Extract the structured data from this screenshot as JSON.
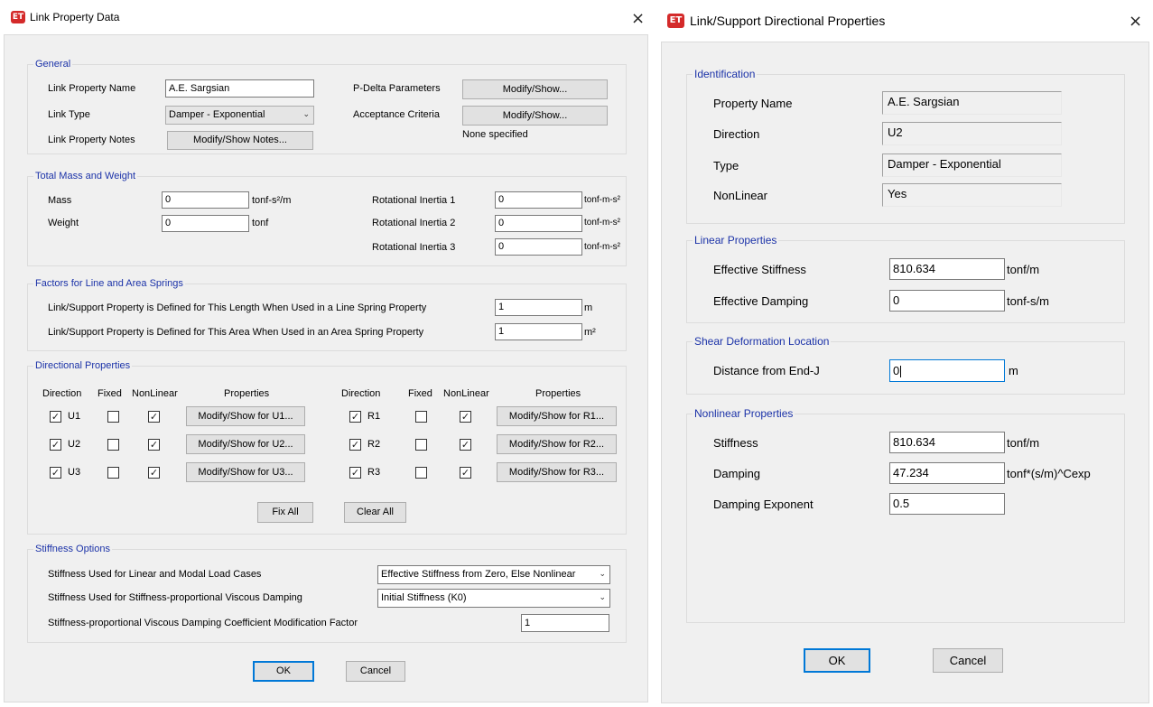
{
  "app_icon_text": "ET",
  "close_glyph": "×",
  "link_dialog": {
    "title": "Link Property Data",
    "general": {
      "title": "General",
      "name_label": "Link Property Name",
      "name_value": "A.E. Sargsian",
      "type_label": "Link Type",
      "type_value": "Damper - Exponential",
      "notes_label": "Link Property Notes",
      "notes_button": "Modify/Show Notes...",
      "pdelta_label": "P-Delta Parameters",
      "pdelta_button": "Modify/Show...",
      "accept_label": "Acceptance Criteria",
      "accept_button": "Modify/Show...",
      "accept_status": "None specified"
    },
    "mass": {
      "title": "Total Mass and Weight",
      "mass_label": "Mass",
      "mass_value": "0",
      "mass_unit": "tonf-s²/m",
      "weight_label": "Weight",
      "weight_value": "0",
      "weight_unit": "tonf",
      "ri1_label": "Rotational Inertia 1",
      "ri1_value": "0",
      "ri1_unit": "tonf-m-s²",
      "ri2_label": "Rotational Inertia 2",
      "ri2_value": "0",
      "ri2_unit": "tonf-m-s²",
      "ri3_label": "Rotational Inertia 3",
      "ri3_value": "0",
      "ri3_unit": "tonf-m-s²"
    },
    "factors": {
      "title": "Factors for Line and Area Springs",
      "line_label": "Link/Support Property is Defined for This Length When Used in a Line Spring Property",
      "line_value": "1",
      "line_unit": "m",
      "area_label": "Link/Support Property is Defined for This Area When Used in an Area Spring Property",
      "area_value": "1",
      "area_unit": "m²"
    },
    "directional": {
      "title": "Directional Properties",
      "headers": {
        "direction": "Direction",
        "fixed": "Fixed",
        "nonlinear": "NonLinear",
        "properties": "Properties"
      },
      "left_rows": [
        {
          "dir": "U1",
          "button": "Modify/Show for U1..."
        },
        {
          "dir": "U2",
          "button": "Modify/Show for U2..."
        },
        {
          "dir": "U3",
          "button": "Modify/Show for U3..."
        }
      ],
      "right_rows": [
        {
          "dir": "R1",
          "button": "Modify/Show for R1..."
        },
        {
          "dir": "R2",
          "button": "Modify/Show for R2..."
        },
        {
          "dir": "R3",
          "button": "Modify/Show for R3..."
        }
      ],
      "fix_all": "Fix All",
      "clear_all": "Clear All"
    },
    "stiffness": {
      "title": "Stiffness Options",
      "linear_label": "Stiffness Used for Linear and Modal Load Cases",
      "linear_value": "Effective Stiffness from Zero, Else Nonlinear",
      "prop_label": "Stiffness Used for Stiffness-proportional Viscous Damping",
      "prop_value": "Initial Stiffness (K0)",
      "coef_label": "Stiffness-proportional Viscous Damping Coefficient Modification Factor",
      "coef_value": "1"
    },
    "ok": "OK",
    "cancel": "Cancel"
  },
  "dir_dialog": {
    "title": "Link/Support Directional Properties",
    "identification": {
      "title": "Identification",
      "name_label": "Property Name",
      "name_value": "A.E. Sargsian",
      "dir_label": "Direction",
      "dir_value": "U2",
      "type_label": "Type",
      "type_value": "Damper - Exponential",
      "nl_label": "NonLinear",
      "nl_value": "Yes"
    },
    "linear": {
      "title": "Linear Properties",
      "eff_stiff_label": "Effective Stiffness",
      "eff_stiff_value": "810.634",
      "eff_stiff_unit": "tonf/m",
      "eff_damp_label": "Effective Damping",
      "eff_damp_value": "0",
      "eff_damp_unit": "tonf-s/m"
    },
    "shear": {
      "title": "Shear Deformation Location",
      "dist_label": "Distance from End-J",
      "dist_value": "0",
      "dist_unit": "m"
    },
    "nonlinear": {
      "title": "Nonlinear Properties",
      "stiff_label": "Stiffness",
      "stiff_value": "810.634",
      "stiff_unit": "tonf/m",
      "damp_label": "Damping",
      "damp_value": "47.234",
      "damp_unit": "tonf*(s/m)^Cexp",
      "exp_label": "Damping Exponent",
      "exp_value": "0.5"
    },
    "ok": "OK",
    "cancel": "Cancel"
  }
}
